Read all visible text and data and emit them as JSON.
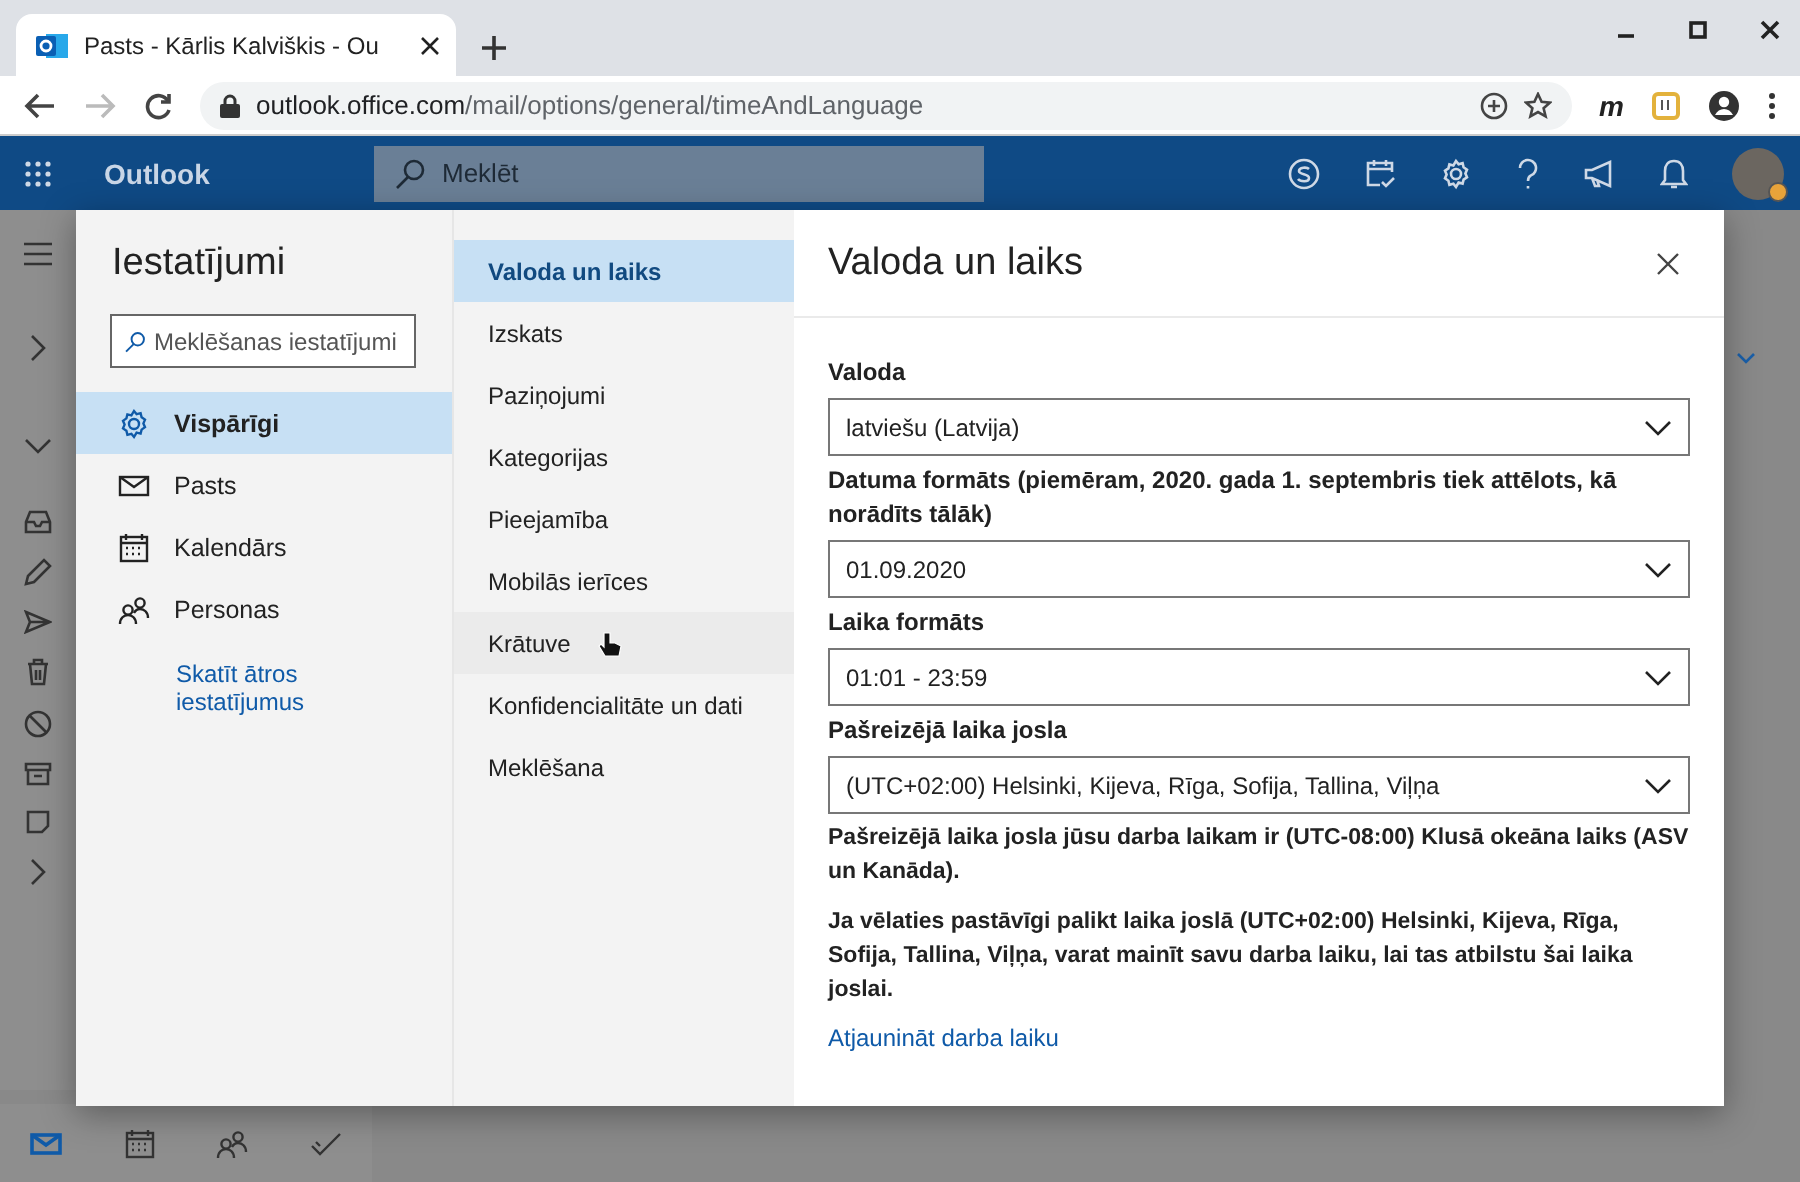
{
  "browser": {
    "tab_title": "Pasts - Kārlis Kalviškis - Ou",
    "url_host": "outlook.office.com",
    "url_path": "/mail/options/general/timeAndLanguage",
    "extension_label": "m"
  },
  "app": {
    "name": "Outlook",
    "search": {
      "placeholder": "Meklēt"
    }
  },
  "bottom_nav": [
    {
      "selected": true
    },
    {
      "selected": false
    },
    {
      "selected": false
    },
    {
      "selected": false
    }
  ],
  "settings": {
    "title": "Iestatījumi",
    "search": {
      "placeholder": "Meklēšanas iestatījumi"
    },
    "categories": [
      {
        "label": "Vispārīgi",
        "selected": true
      },
      {
        "label": "Pasts",
        "selected": false
      },
      {
        "label": "Kalendārs",
        "selected": false
      },
      {
        "label": "Personas",
        "selected": false
      }
    ],
    "quick_link": "Skatīt ātros iestatījumus",
    "subnav": [
      {
        "label": "Valoda un laiks",
        "selected": true,
        "hovered": false
      },
      {
        "label": "Izskats",
        "selected": false,
        "hovered": false
      },
      {
        "label": "Paziņojumi",
        "selected": false,
        "hovered": false
      },
      {
        "label": "Kategorijas",
        "selected": false,
        "hovered": false
      },
      {
        "label": "Pieejamība",
        "selected": false,
        "hovered": false
      },
      {
        "label": "Mobilās ierīces",
        "selected": false,
        "hovered": false
      },
      {
        "label": "Krātuve",
        "selected": false,
        "hovered": true
      },
      {
        "label": "Konfidencialitāte un dati",
        "selected": false,
        "hovered": false
      },
      {
        "label": "Meklēšana",
        "selected": false,
        "hovered": false
      }
    ],
    "panel": {
      "title": "Valoda un laiks",
      "fields": [
        {
          "label": "Valoda",
          "value": "latviešu (Latvija)"
        },
        {
          "label": "Datuma formāts (piemēram, 2020. gada 1. septembris tiek attēlots, kā norādīts tālāk)",
          "value": "01.09.2020"
        },
        {
          "label": "Laika formāts",
          "value": "01:01 - 23:59"
        },
        {
          "label": "Pašreizējā laika josla",
          "value": "(UTC+02:00) Helsinki, Kijeva, Rīga, Sofija, Tallina, Viļņa"
        }
      ],
      "notes": [
        "Pašreizējā laika josla jūsu darba laikam ir (UTC-08:00) Klusā okeāna laiks (ASV un Kanāda).",
        "Ja vēlaties pastāvīgi palikt laika joslā (UTC+02:00) Helsinki, Kijeva, Rīga, Sofija, Tallina, Viļņa, varat mainīt savu darba laiku, lai tas atbilstu šai laika joslai."
      ],
      "link": "Atjaunināt darba laiku"
    }
  }
}
